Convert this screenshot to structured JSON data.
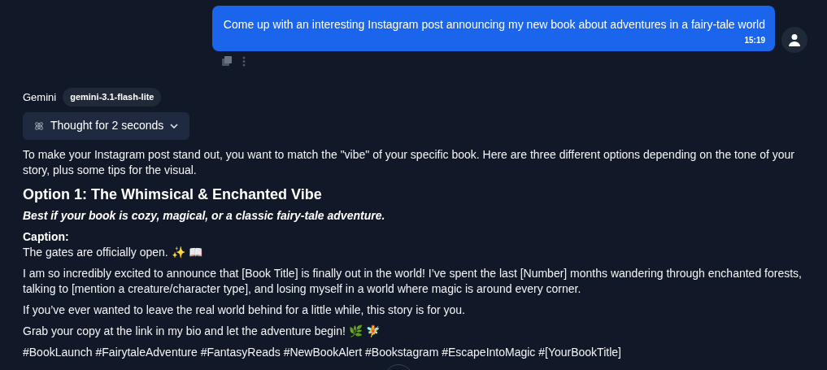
{
  "user_message": {
    "text": "Come up with an interesting Instagram post announcing my new book about adventures in a fairy-tale world",
    "time": "15:19"
  },
  "assistant": {
    "name": "Gemini",
    "model": "gemini-3.1-flash-lite",
    "thought": "Thought for 2 seconds",
    "blocks": [
      {
        "kind": "paragraph",
        "text": "To make your Instagram post stand out, you want to match the \"vibe\" of your specific book. Here are three different options depending on the tone of your story, plus some tips for the visual."
      },
      {
        "kind": "heading",
        "text": "Option 1: The Whimsical & Enchanted Vibe"
      },
      {
        "kind": "emphasis",
        "text": "Best if your book is cozy, magical, or a classic fairy-tale adventure."
      },
      {
        "kind": "label",
        "text": "Caption:"
      },
      {
        "kind": "line",
        "text": "The gates are officially open. ✨ 📖"
      },
      {
        "kind": "paragraph",
        "text": "I am so incredibly excited to announce that [Book Title] is finally out in the world! I’ve spent the last [Number] months wandering through enchanted forests, talking to [mention a creature/character type], and losing myself in a world where magic is around every corner."
      },
      {
        "kind": "paragraph",
        "text": "If you’ve ever wanted to leave the real world behind for a little while, this story is for you."
      },
      {
        "kind": "paragraph",
        "text": "Grab your copy at the link in my bio and let the adventure begin! 🌿 🧚"
      },
      {
        "kind": "paragraph",
        "text": "#BookLaunch #FairytaleAdventure #FantasyReads #NewBookAlert #Bookstagram #EscapeIntoMagic #[YourBookTitle]"
      }
    ]
  }
}
